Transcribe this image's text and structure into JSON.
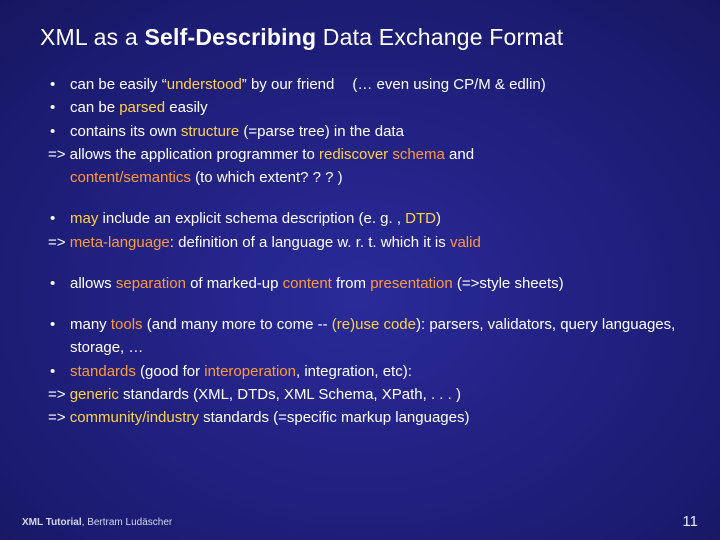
{
  "title": {
    "pre": "XML as a ",
    "strong": "Self-Describing",
    "post": " Data Exchange Format"
  },
  "b1": {
    "l1_a": "can be easily ",
    "l1_q1": "“",
    "l1_u": "understood",
    "l1_q2": "” ",
    "l1_b": "by our friend",
    "l1_c": "(… even using CP/M & edlin)",
    "l2_a": "can be ",
    "l2_b": "parsed",
    "l2_c": " easily",
    "l3_a": "contains its own ",
    "l3_b": "structure ",
    "l3_c": "(=parse tree) in the data",
    "l4_a": "=> allows the application programmer to ",
    "l4_b": "rediscover ",
    "l4_c": "schema ",
    "l4_d": " and",
    "l5_a": "content/semantics",
    "l5_b": " (to which extent? ? ? )"
  },
  "b2": {
    "l1_a": "may ",
    "l1_b": " include an explicit schema description (e. g. , ",
    "l1_c": "DTD",
    "l1_d": ")",
    "l2_a": "=> ",
    "l2_b": "meta-language",
    "l2_c": ": definition of a language w. r. t. which it is ",
    "l2_d": "valid"
  },
  "b3": {
    "l1_a": "allows ",
    "l1_b": "separation",
    "l1_c": " of marked-up ",
    "l1_d": "content ",
    "l1_e": "from ",
    "l1_f": "presentation ",
    "l1_g": "(=>style sheets)"
  },
  "b4": {
    "l1_a": "many ",
    "l1_b": "tools",
    "l1_c": " (and many more to come -- ",
    "l1_d": "(re)use code",
    "l1_e": "): parsers, validators, query languages, storage, …",
    "l2_a": "standards",
    "l2_b": " (good for ",
    "l2_c": "interoperation",
    "l2_d": ", integration, etc):",
    "l3_a": "=> ",
    "l3_b": "generic",
    "l3_c": " standards (XML, DTDs, XML Schema, XPath, . . . )",
    "l4_a": "=> ",
    "l4_b": "community/industry",
    "l4_c": " standards (=specific markup languages)"
  },
  "footer": {
    "main": "XML Tutorial",
    "sep": ", ",
    "author": "Bertram Ludäscher"
  },
  "page": "11"
}
